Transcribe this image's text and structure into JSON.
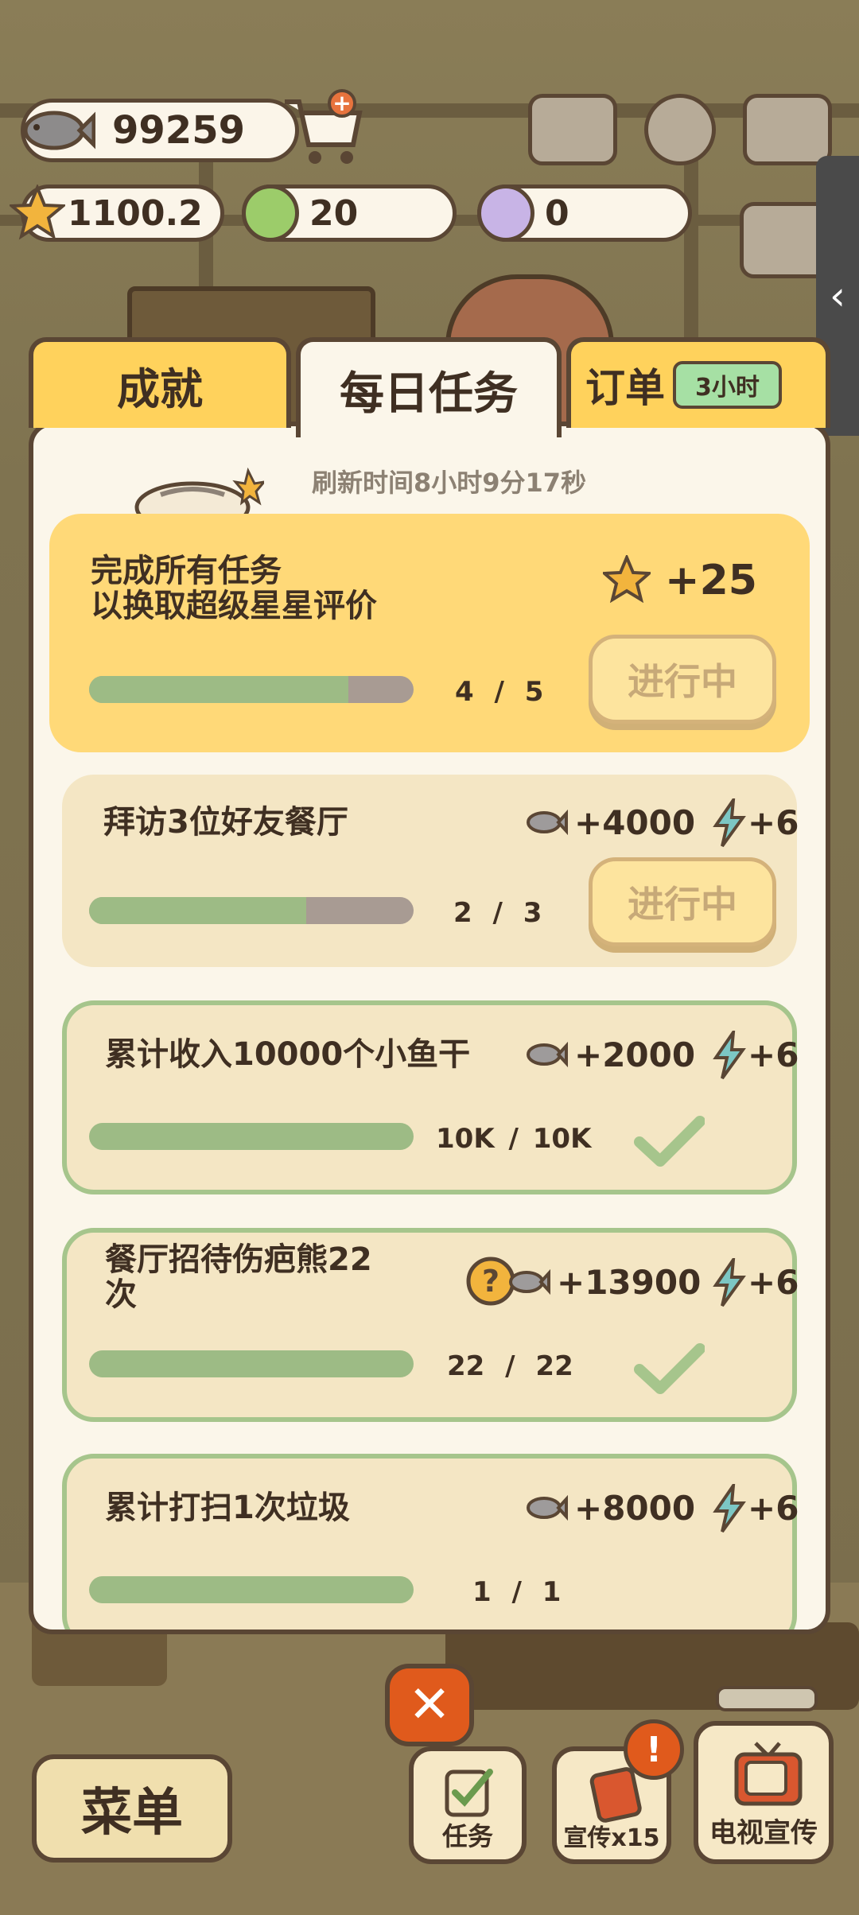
{
  "hud": {
    "fish_amount": "99259",
    "star_rating": "1100.2",
    "green_token": "20",
    "paw_token": "0"
  },
  "tabs": [
    {
      "label": "成就"
    },
    {
      "label": "每日任务"
    },
    {
      "label": "订单",
      "badge": "3小时"
    }
  ],
  "refresh_text": "刷新时间8小时9分17秒",
  "tasks": [
    {
      "title_line1": "完成所有任务",
      "title_line2": "以换取超级星星评价",
      "reward": "+25",
      "progress": "4 / 5",
      "progress_fraction": 0.8,
      "button": "进行中"
    },
    {
      "title": "拜访3位好友餐厅",
      "reward_fish": "+4000",
      "reward_bolt": "+6",
      "progress": "2 / 3",
      "progress_fraction": 0.67,
      "button": "进行中"
    },
    {
      "title": "累计收入10000个小鱼干",
      "reward_fish": "+2000",
      "reward_bolt": "+6",
      "progress": "10K / 10K",
      "progress_fraction": 1.0
    },
    {
      "title_line1": "餐厅招待伤疤熊22",
      "title_line2": "次",
      "reward_fish": "+13900",
      "reward_bolt": "+6",
      "progress": "22 / 22",
      "progress_fraction": 1.0
    },
    {
      "title": "累计打扫1次垃圾",
      "reward_fish": "+8000",
      "reward_bolt": "+6",
      "progress": "1 / 1",
      "progress_fraction": 1.0
    }
  ],
  "close_label": "✕",
  "bottom": {
    "menu": "菜单",
    "tasks": "任务",
    "promo": "宣传x15",
    "tv_promo": "电视宣传"
  },
  "side_handle": "‹",
  "colors": {
    "accent": "#fde49e",
    "highlight_task": "#ffd978",
    "task_bg": "#f4e6c4",
    "done_border": "#a6c58c",
    "close": "#e05a1c"
  }
}
